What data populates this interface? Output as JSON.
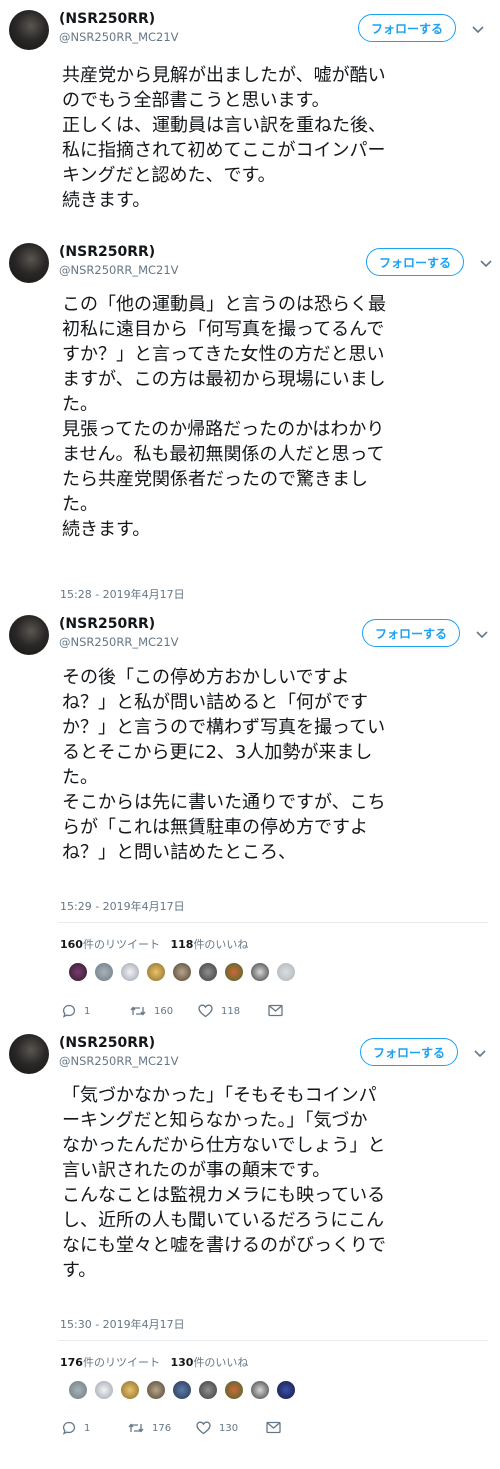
{
  "follow_label": "フォローする",
  "tweets": [
    {
      "display_name": "(NSR250RR)",
      "handle": "@NSR250RR_MC21V",
      "text": "共産党から見解が出ましたが、嘘が酷い\nのでもう全部書こうと思います。\n正しくは、運動員は言い訳を重ねた後、\n私に指摘されて初めてここがコインパー\nキングだと認めた、です。\n続きます。"
    },
    {
      "display_name": "(NSR250RR)",
      "handle": "@NSR250RR_MC21V",
      "text": "この「他の運動員」と言うのは恐らく最\n初私に遠目から「何写真を撮ってるんで\nすか？」と言ってきた女性の方だと思い\nますが、この方は最初から現場にいまし\nた。\n見張ってたのか帰路だったのかはわかり\nません。私も最初無関係の人だと思って\nたら共産党関係者だったので驚きまし\nた。\n続きます。",
      "timestamp": "15:28 - 2019年4月17日"
    },
    {
      "display_name": "(NSR250RR)",
      "handle": "@NSR250RR_MC21V",
      "text": "その後「この停め方おかしいですよ\nね？」と私が問い詰めると「何がです\nか？」と言うので構わず写真を撮ってい\nるとそこから更に2、3人加勢が来まし\nた。\nそこからは先に書いた通りですが、こち\nらが「これは無賃駐車の停め方ですよ\nね？」と問い詰めたところ、",
      "timestamp": "15:29 - 2019年4月17日",
      "retweets": "160",
      "retweets_label": "件のリツイート",
      "likes": "118",
      "likes_label": "件のいいね",
      "replies": "1",
      "retweet_count": "160",
      "like_count": "118"
    },
    {
      "display_name": "(NSR250RR)",
      "handle": "@NSR250RR_MC21V",
      "text": "「気づかなかった」「そもそもコインパ\nーキングだと知らなかった。」「気づか\nなかったんだから仕方ないでしょう」と\n言い訳されたのが事の顛末です。\nこんなことは監視カメラにも映っている\nし、近所の人も聞いているだろうにこん\nなにも堂々と嘘を書けるのがびっくりで\nす。",
      "timestamp": "15:30 - 2019年4月17日",
      "retweets": "176",
      "retweets_label": "件のリツイート",
      "likes": "130",
      "likes_label": "件のいいね",
      "replies": "1",
      "retweet_count": "176",
      "like_count": "130"
    }
  ],
  "colors": {
    "accent": "#1da1f2",
    "muted": "#657786",
    "text": "#14171a",
    "border": "#e6ecf0"
  },
  "icons": [
    "reply-icon",
    "retweet-icon",
    "like-icon",
    "dm-icon",
    "chevron-down-icon"
  ]
}
